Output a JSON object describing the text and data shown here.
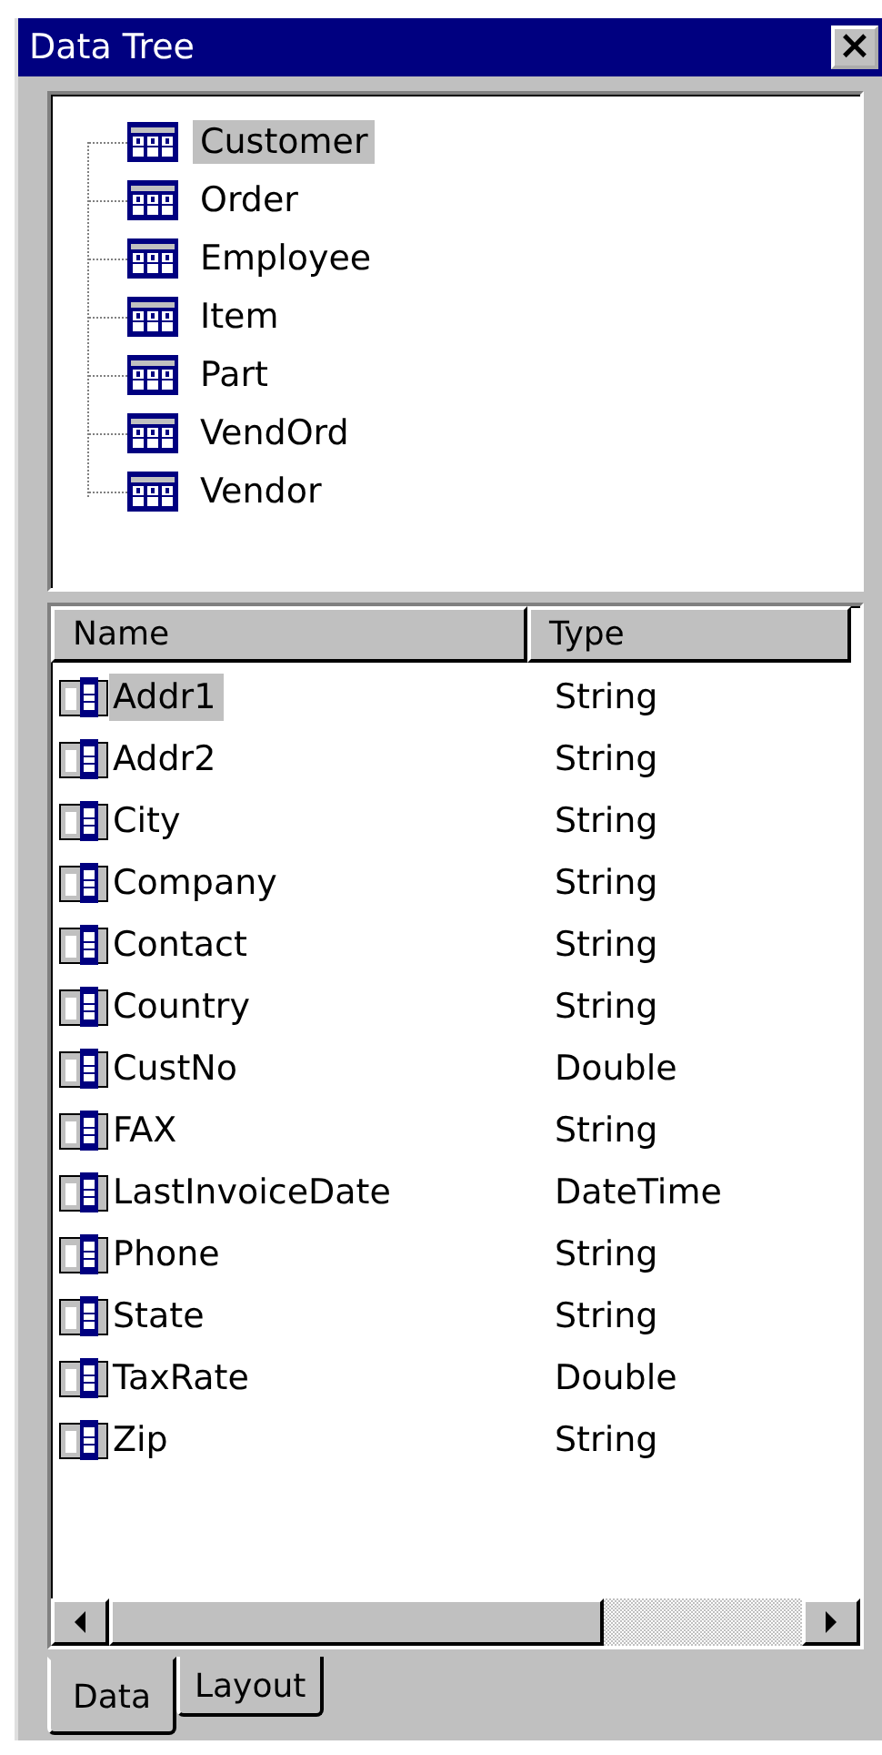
{
  "window": {
    "title": "Data Tree",
    "close": "×"
  },
  "tree": {
    "items": [
      {
        "label": "Customer",
        "selected": true
      },
      {
        "label": "Order",
        "selected": false
      },
      {
        "label": "Employee",
        "selected": false
      },
      {
        "label": "Item",
        "selected": false
      },
      {
        "label": "Part",
        "selected": false
      },
      {
        "label": "VendOrd",
        "selected": false
      },
      {
        "label": "Vendor",
        "selected": false
      }
    ]
  },
  "table": {
    "columns": [
      "Name",
      "Type"
    ],
    "rows": [
      {
        "name": "Addr1",
        "type": "String",
        "selected": true
      },
      {
        "name": "Addr2",
        "type": "String",
        "selected": false
      },
      {
        "name": "City",
        "type": "String",
        "selected": false
      },
      {
        "name": "Company",
        "type": "String",
        "selected": false
      },
      {
        "name": "Contact",
        "type": "String",
        "selected": false
      },
      {
        "name": "Country",
        "type": "String",
        "selected": false
      },
      {
        "name": "CustNo",
        "type": "Double",
        "selected": false
      },
      {
        "name": "FAX",
        "type": "String",
        "selected": false
      },
      {
        "name": "LastInvoiceDate",
        "type": "DateTime",
        "selected": false
      },
      {
        "name": "Phone",
        "type": "String",
        "selected": false
      },
      {
        "name": "State",
        "type": "String",
        "selected": false
      },
      {
        "name": "TaxRate",
        "type": "Double",
        "selected": false
      },
      {
        "name": "Zip",
        "type": "String",
        "selected": false
      }
    ]
  },
  "tabs": [
    {
      "label": "Data",
      "selected": true
    },
    {
      "label": "Layout",
      "selected": false
    }
  ]
}
